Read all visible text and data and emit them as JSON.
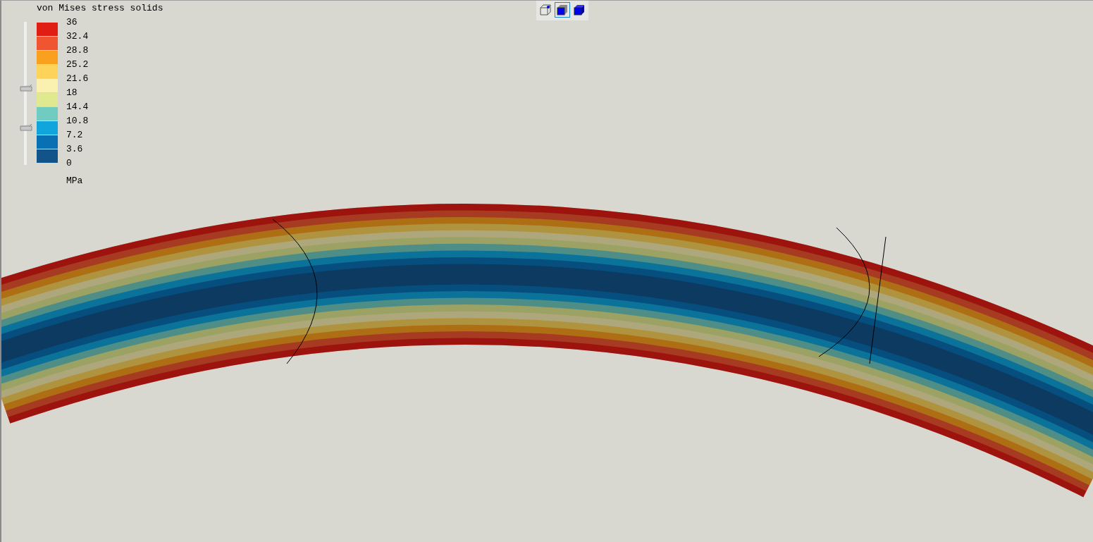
{
  "legend": {
    "title": "von Mises stress solids",
    "unit": "MPa",
    "bands": [
      {
        "color": "#e01e14"
      },
      {
        "color": "#f05532"
      },
      {
        "color": "#f9a01e"
      },
      {
        "color": "#fdd35a"
      },
      {
        "color": "#faf0b0"
      },
      {
        "color": "#e0e890"
      },
      {
        "color": "#70ccc0"
      },
      {
        "color": "#10a5dc"
      },
      {
        "color": "#0a70b4"
      },
      {
        "color": "#12548a"
      }
    ],
    "labels": [
      "36",
      "32.4",
      "28.8",
      "25.2",
      "21.6",
      "18",
      "14.4",
      "10.8",
      "7.2",
      "3.6",
      "0"
    ],
    "range_handles": [
      {
        "level": 0.53
      },
      {
        "level": 0.25
      }
    ]
  },
  "toolbar": [
    {
      "kind": "wireframe",
      "selected": false
    },
    {
      "kind": "solid",
      "selected": true
    },
    {
      "kind": "shaded",
      "selected": false
    }
  ]
}
